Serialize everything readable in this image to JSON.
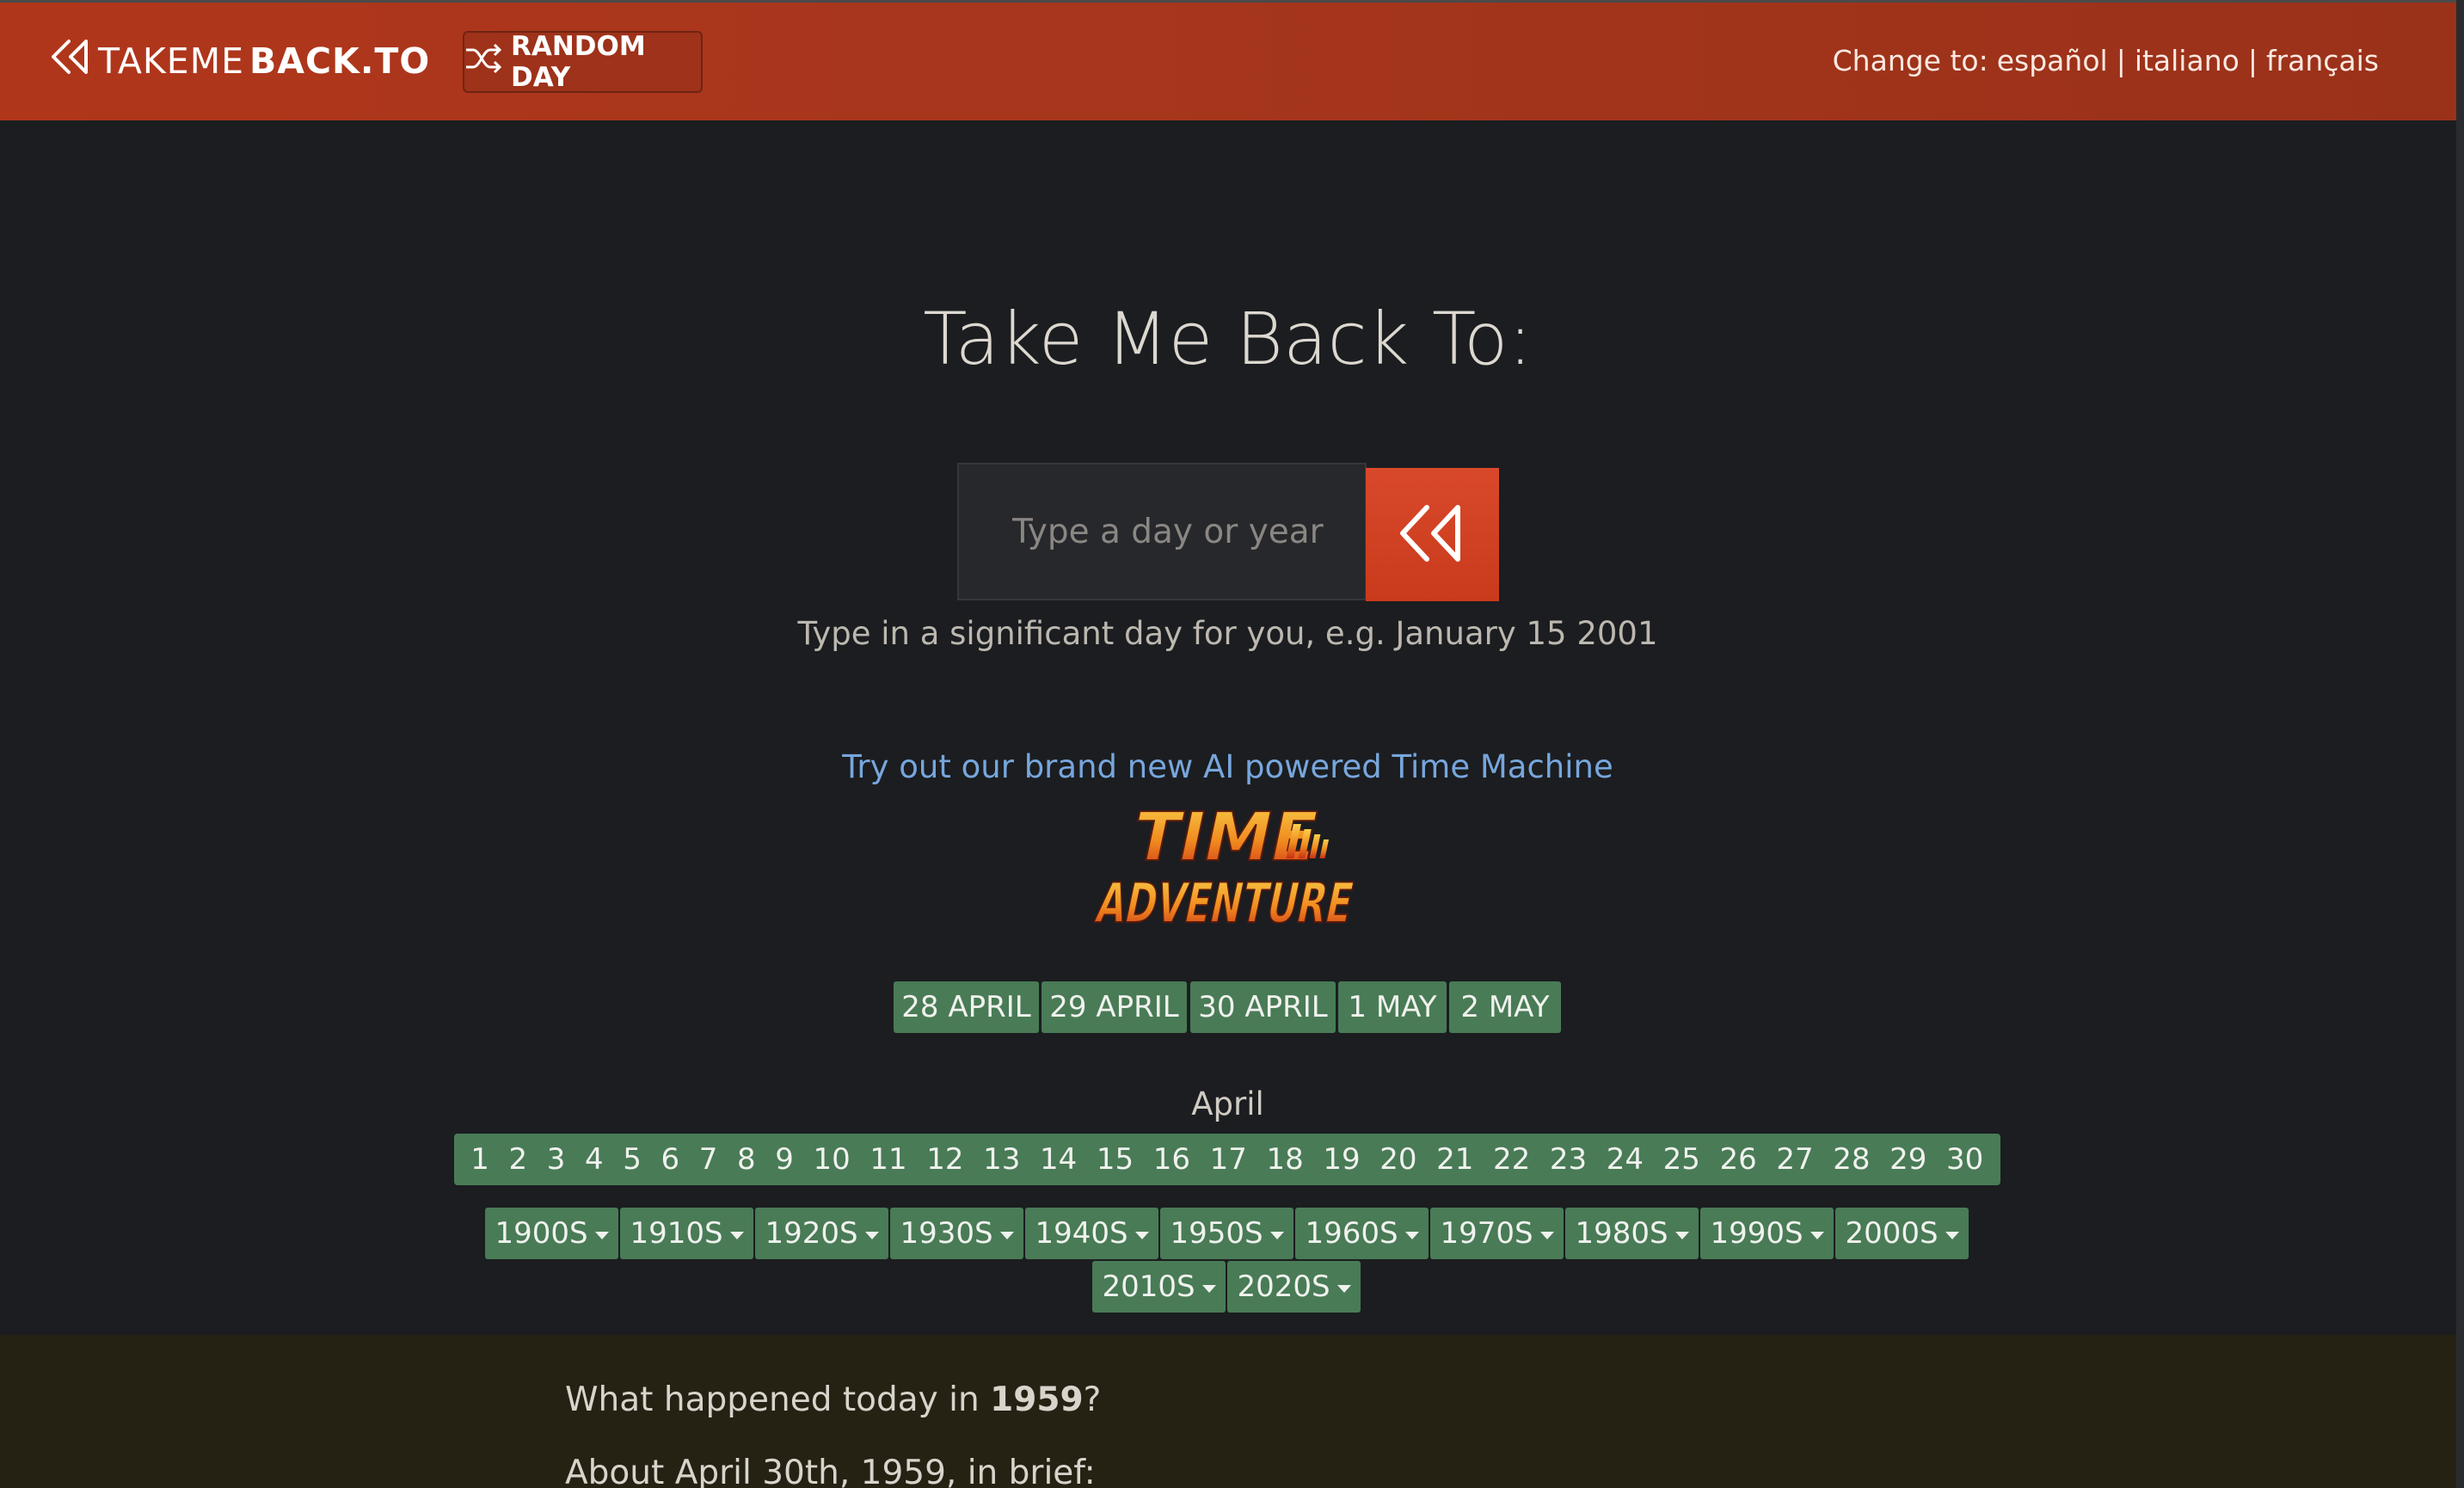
{
  "header": {
    "brand_light": "TAKEME",
    "brand_bold": "BACK.TO",
    "random_label": "RANDOM DAY",
    "lang_prefix": "Change to:",
    "languages": [
      "español",
      "italiano",
      "français"
    ],
    "separator": "|"
  },
  "hero": {
    "title": "Take Me Back To:",
    "search_placeholder": "Type a day or year",
    "hint": "Type in a significant day for you, e.g. January 15 2001",
    "ai_link": "Try out our brand new AI powered Time Machine",
    "logo_line1": "TIME",
    "logo_line2": "ADVENTURE"
  },
  "nearby_dates": [
    "28 APRIL",
    "29 APRIL",
    "30 APRIL",
    "1 MAY",
    "2 MAY"
  ],
  "month": {
    "label": "April",
    "days": [
      "1",
      "2",
      "3",
      "4",
      "5",
      "6",
      "7",
      "8",
      "9",
      "10",
      "11",
      "12",
      "13",
      "14",
      "15",
      "16",
      "17",
      "18",
      "19",
      "20",
      "21",
      "22",
      "23",
      "24",
      "25",
      "26",
      "27",
      "28",
      "29",
      "30"
    ]
  },
  "decades": [
    "1900S",
    "1910S",
    "1920S",
    "1930S",
    "1940S",
    "1950S",
    "1960S",
    "1970S",
    "1980S",
    "1990S",
    "2000S",
    "2010S",
    "2020S"
  ],
  "panel": {
    "question_prefix": "What happened today in ",
    "year": "1959",
    "question_suffix": "?",
    "about": "About April 30th, 1959, in brief:"
  },
  "colors": {
    "header": "#a6361c",
    "accent": "#c93b1c",
    "chip": "#497b56",
    "background": "#1b1d20",
    "panel": "#252214",
    "link": "#77a6dc"
  },
  "icons": {
    "brand": "double-rewind-icon",
    "random": "shuffle-icon",
    "go": "double-rewind-icon"
  }
}
